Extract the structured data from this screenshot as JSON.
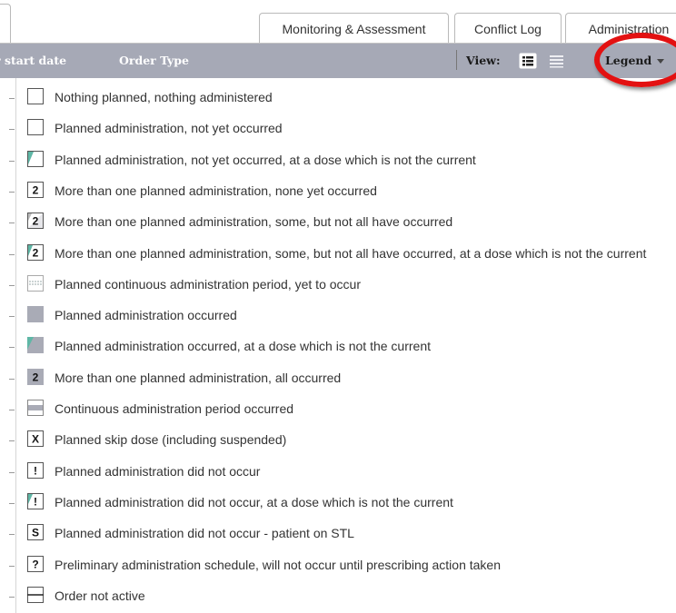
{
  "tabs": [
    {
      "label": "Monitoring & Assessment"
    },
    {
      "label": "Conflict Log"
    },
    {
      "label": "Administration"
    }
  ],
  "toolbar": {
    "col_start_label": "r start date",
    "col_ordertype_label": "Order Type",
    "view_label": "View:",
    "legend_label": "Legend"
  },
  "legend_items": [
    {
      "symbol": "empty-box",
      "glyph": "",
      "label": "Nothing planned, nothing administered"
    },
    {
      "symbol": "empty-box",
      "glyph": "",
      "label": "Planned administration, not yet occurred"
    },
    {
      "symbol": "box-teal-corner",
      "glyph": "",
      "label": "Planned administration, not yet occurred, at a dose which is not the current"
    },
    {
      "symbol": "box-number",
      "glyph": "2",
      "label": "More than one planned administration, none yet occurred"
    },
    {
      "symbol": "box-number-partial",
      "glyph": "2",
      "label": "More than one planned administration, some, but not all have occurred"
    },
    {
      "symbol": "box-number-partial-teal",
      "glyph": "2",
      "label": "More than one planned administration, some, but not all have occurred, at a dose which is not the current"
    },
    {
      "symbol": "continuous-planned",
      "glyph": "",
      "label": "Planned continuous administration period, yet to occur"
    },
    {
      "symbol": "grey-box",
      "glyph": "",
      "label": "Planned administration occurred"
    },
    {
      "symbol": "grey-box-teal-corner",
      "glyph": "",
      "label": "Planned administration occurred, at a dose which is not the current"
    },
    {
      "symbol": "grey-box-number",
      "glyph": "2",
      "label": "More than one planned administration, all occurred"
    },
    {
      "symbol": "continuous-occurred",
      "glyph": "",
      "label": "Continuous administration period occurred"
    },
    {
      "symbol": "box-glyph",
      "glyph": "X",
      "label": "Planned skip dose (including suspended)"
    },
    {
      "symbol": "box-glyph",
      "glyph": "!",
      "label": "Planned administration did not occur"
    },
    {
      "symbol": "box-glyph-teal",
      "glyph": "!",
      "label": "Planned administration did not occur, at a dose which is not the current"
    },
    {
      "symbol": "box-glyph",
      "glyph": "S",
      "label": "Planned administration did not occur - patient on STL"
    },
    {
      "symbol": "box-glyph",
      "glyph": "?",
      "label": "Preliminary administration schedule, will not occur until prescribing action taken"
    },
    {
      "symbol": "box-midline",
      "glyph": "",
      "label": "Order not active"
    }
  ],
  "colors": {
    "toolbar_bg": "#a6a9b6",
    "occurred_grey": "#a9abb6",
    "dose_teal": "#5fb7a6",
    "highlight_ring": "#e31111"
  }
}
